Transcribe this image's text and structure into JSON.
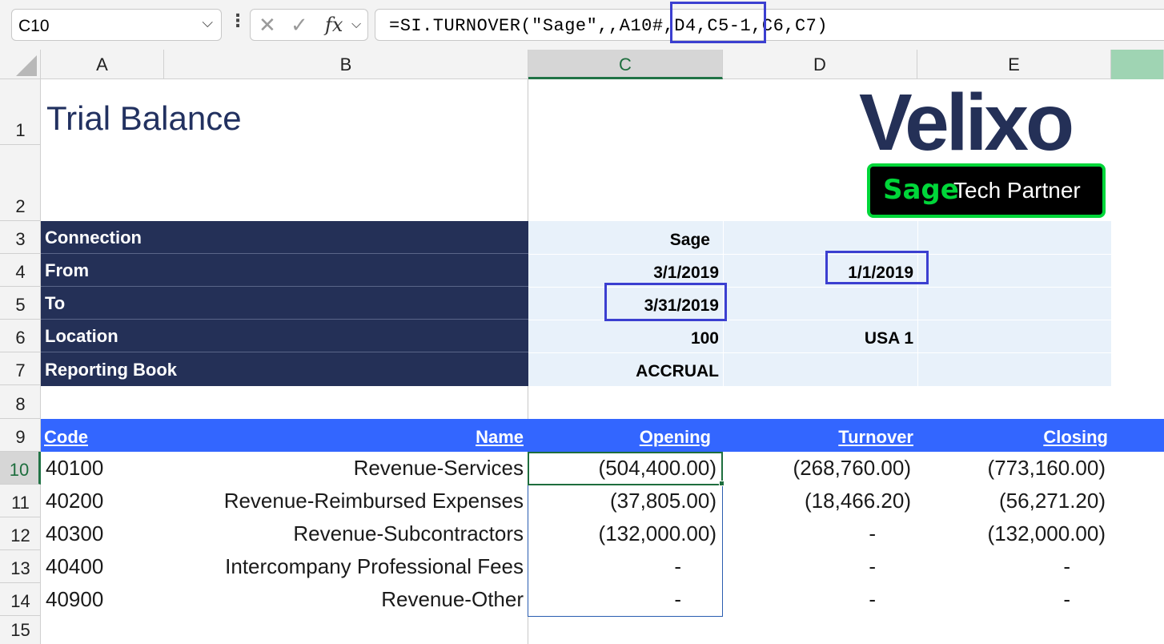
{
  "formula_bar": {
    "name_box": "C10",
    "formula": "=SI.TURNOVER(\"Sage\",,A10#,D4,C5-1,C6,C7)",
    "cancel_glyph": "✕",
    "enter_glyph": "✓",
    "fx_label": "fx"
  },
  "columns": [
    "A",
    "B",
    "C",
    "D",
    "E"
  ],
  "rows": [
    "1",
    "2",
    "3",
    "4",
    "5",
    "6",
    "7",
    "8",
    "9",
    "10",
    "11",
    "12",
    "13",
    "14",
    "15"
  ],
  "sheet": {
    "title": "Trial Balance",
    "params": {
      "labels": [
        "Connection",
        "From",
        "To",
        "Location",
        "Reporting Book"
      ],
      "c_values": [
        "Sage",
        "3/1/2019",
        "3/31/2019",
        "100",
        "ACCRUAL"
      ],
      "d_from": "1/1/2019",
      "d_location": "USA 1"
    },
    "headers": {
      "code": "Code",
      "name": "Name",
      "opening": "Opening",
      "turnover": "Turnover",
      "closing": "Closing"
    },
    "accounts": [
      {
        "code": "40100",
        "name": "Revenue-Services",
        "opening": "(504,400.00)",
        "turnover": "(268,760.00)",
        "closing": "(773,160.00)"
      },
      {
        "code": "40200",
        "name": "Revenue-Reimbursed Expenses",
        "opening": "(37,805.00)",
        "turnover": "(18,466.20)",
        "closing": "(56,271.20)"
      },
      {
        "code": "40300",
        "name": "Revenue-Subcontractors",
        "opening": "(132,000.00)",
        "turnover": "-",
        "closing": "(132,000.00)"
      },
      {
        "code": "40400",
        "name": "Intercompany Professional Fees",
        "opening": "-",
        "turnover": "-",
        "closing": "-"
      },
      {
        "code": "40900",
        "name": "Revenue-Other",
        "opening": "-",
        "turnover": "-",
        "closing": "-"
      }
    ]
  },
  "logo": {
    "brand": "Velixo",
    "badge_sage": "Sage",
    "badge_text": "Tech Partner"
  },
  "colors": {
    "label_bg": "#243057",
    "param_bg": "#e8f1fa",
    "header_band": "#3366ff",
    "highlight_box": "#3b3fd0",
    "sage_green": "#00d639"
  }
}
